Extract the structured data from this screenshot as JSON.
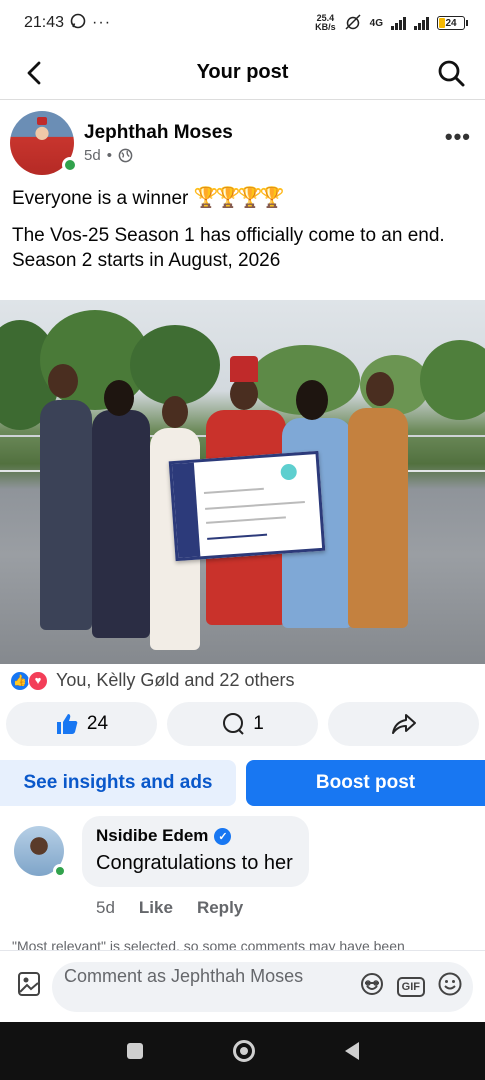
{
  "status_bar": {
    "time": "21:43",
    "speed_value": "25.4",
    "speed_unit": "KB/s",
    "network": "4G",
    "battery": "24"
  },
  "header": {
    "title": "Your post",
    "back_icon": "back-arrow-icon",
    "search_icon": "search-icon"
  },
  "post": {
    "author": "Jephthah Moses",
    "time": "5d",
    "separator": "•",
    "privacy_icon": "globe-icon",
    "more_label": "•••",
    "text_line1": "Everyone is a winner",
    "trophies": [
      "🏆",
      "🏆",
      "🏆",
      "🏆"
    ],
    "text_line2": "The Vos-25 Season 1 has officially come to an end. Season 2 starts in August, 2026"
  },
  "reactions": {
    "summary": "You, Kèlly Gøld and 22 others"
  },
  "actions": {
    "like_count": "24",
    "comment_count": "1"
  },
  "promo": {
    "insights_label": "See insights and ads",
    "boost_label": "Boost post"
  },
  "comment": {
    "author": "Nsidibe Edem",
    "text": "Congratulations to her",
    "time": "5d",
    "like_label": "Like",
    "reply_label": "Reply"
  },
  "notice": "\"Most relevant\" is selected, so some comments may have been",
  "composer": {
    "placeholder": "Comment as Jephthah Moses",
    "gif_label": "GIF"
  },
  "colors": {
    "accent": "#1877f2",
    "online": "#31a24c",
    "love": "#f33e58"
  }
}
